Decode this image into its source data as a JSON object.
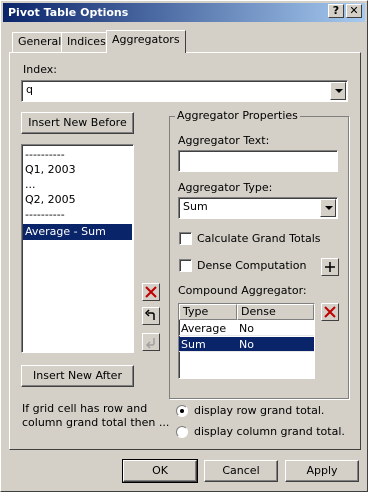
{
  "window": {
    "title": "Pivot Table Options",
    "help_button": "?",
    "close_button": "✕"
  },
  "tabs": [
    {
      "label": "General",
      "active": false
    },
    {
      "label": "Indices",
      "active": false
    },
    {
      "label": "Aggregators",
      "active": true
    }
  ],
  "index": {
    "label": "Index:",
    "value": "q"
  },
  "buttons": {
    "insert_before": "Insert New Before",
    "insert_after": "Insert New After",
    "ok": "OK",
    "cancel": "Cancel",
    "apply": "Apply"
  },
  "aggregator_list": {
    "items": [
      "----------",
      "Q1, 2003",
      "...",
      "Q2, 2005",
      "----------",
      "Average - Sum"
    ],
    "selected_index": 5
  },
  "properties": {
    "group_title": "Aggregator Properties",
    "text_label": "Aggregator Text:",
    "text_value": "",
    "type_label": "Aggregator Type:",
    "type_value": "Sum",
    "calc_grand_totals_label": "Calculate Grand Totals",
    "calc_grand_totals_checked": false,
    "dense_label": "Dense Computation",
    "dense_checked": false,
    "compound_label": "Compound Aggregator:",
    "compound_columns": [
      "Type",
      "Dense"
    ],
    "compound_rows": [
      {
        "type": "Average",
        "dense": "No",
        "selected": false
      },
      {
        "type": "Sum",
        "dense": "No",
        "selected": true
      }
    ]
  },
  "grand_total": {
    "question": "If grid cell has row and column grand total then ...",
    "options": [
      "display row grand total.",
      "display column grand total."
    ],
    "selected_index": 0
  },
  "colors": {
    "title_start": "#0a246a",
    "title_end": "#a6caf0",
    "selection": "#0a246a",
    "delete_red": "#c00000"
  }
}
